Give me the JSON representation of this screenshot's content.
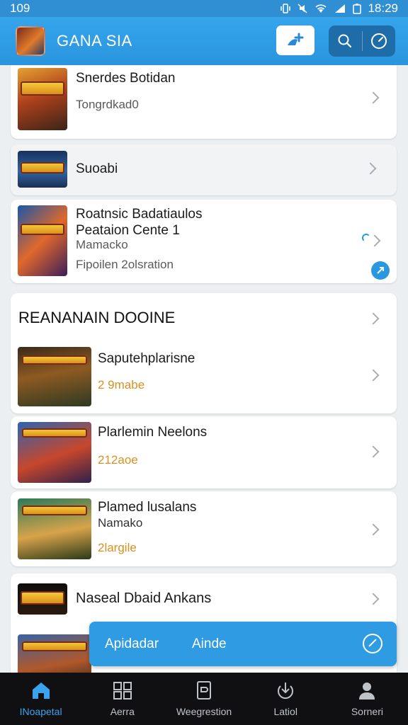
{
  "status_bar": {
    "time_left": "109",
    "time_right": "18:29"
  },
  "app_bar": {
    "title": "GANA SIA"
  },
  "items": [
    {
      "title": "Snerdes Botidan",
      "subtitle": "Tongrdkad0"
    },
    {
      "title": "Suoabi"
    },
    {
      "title_line1": "Roatnsic Badatiaulos",
      "title_line2": "Peataion Cente 1",
      "subtitle": "Mamacko",
      "detail": "Fipoilen 2olsration"
    }
  ],
  "section": {
    "title": "REANANAIN DOOINE",
    "items": [
      {
        "title": "Saputehplarisne",
        "meta": "2 9mabe"
      },
      {
        "title": "Plarlemin Neelons",
        "meta": "212aoe"
      },
      {
        "title": "Plamed lusalans",
        "subtitle": "Namako",
        "meta": "2largile"
      },
      {
        "title": "Naseal Dbaid Ankans"
      }
    ]
  },
  "snackbar": {
    "label_primary": "Apidadar",
    "label_action": "Ainde"
  },
  "bottom_nav": [
    {
      "label": "INoapetal",
      "icon": "home-icon",
      "active": true
    },
    {
      "label": "Aerra",
      "icon": "grid-icon",
      "active": false
    },
    {
      "label": "Weegrestion",
      "icon": "page-icon",
      "active": false
    },
    {
      "label": "Latiol",
      "icon": "download-icon",
      "active": false
    },
    {
      "label": "Sorneri",
      "icon": "person-icon",
      "active": false
    }
  ],
  "colors": {
    "primary": "#2a95de",
    "accent_meta": "#d89020",
    "nav_active": "#3aa3ee",
    "nav_bg": "#101012"
  }
}
